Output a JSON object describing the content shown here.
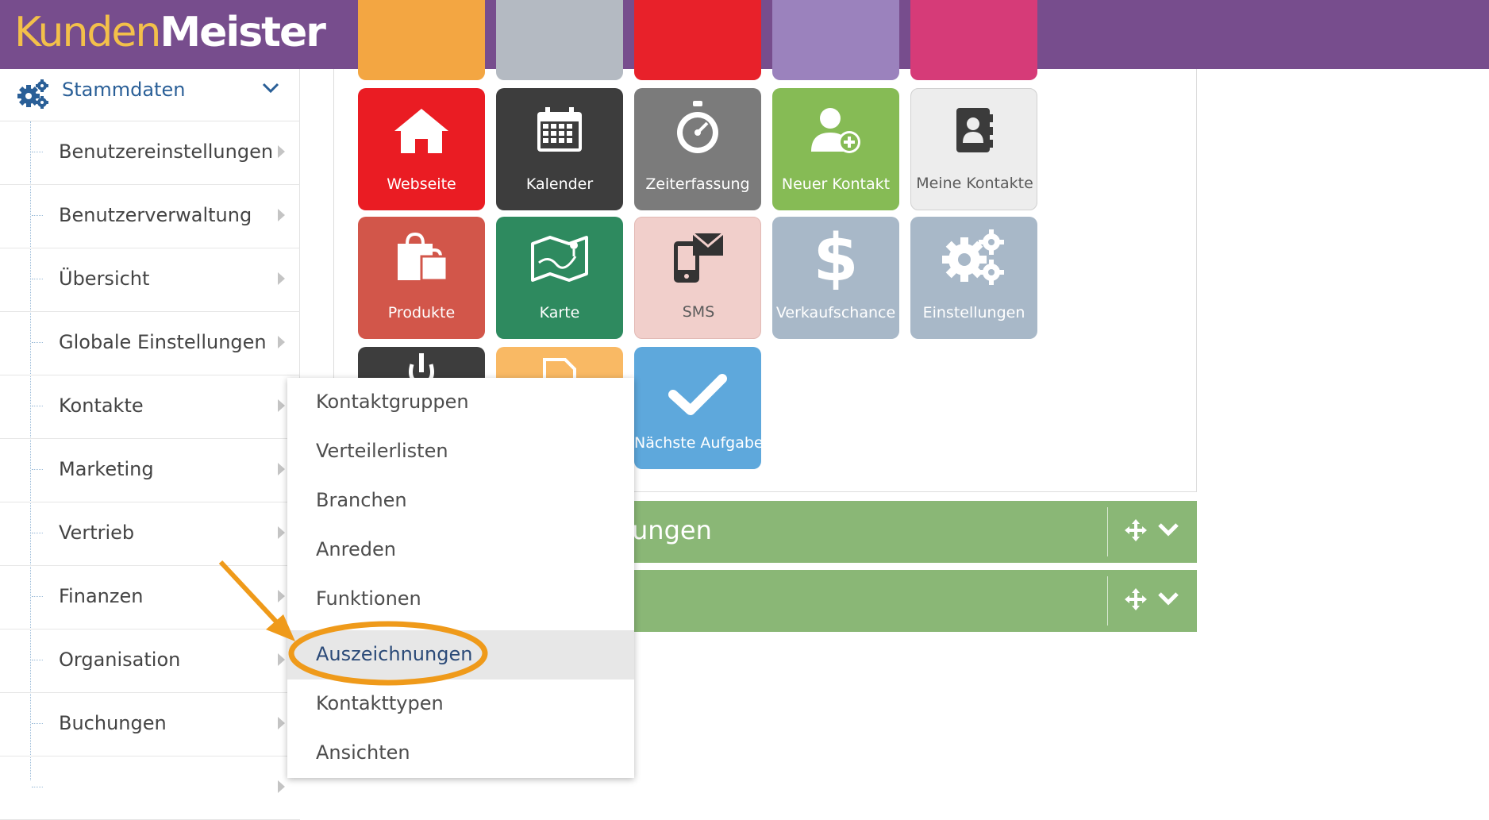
{
  "brand": {
    "part1": "Kunden",
    "part2": "Meister"
  },
  "sidebar": {
    "header": "Stammdaten",
    "items": [
      {
        "label": "Benutzereinstellungen"
      },
      {
        "label": "Benutzerverwaltung"
      },
      {
        "label": "Übersicht"
      },
      {
        "label": "Globale Einstellungen"
      },
      {
        "label": "Kontakte"
      },
      {
        "label": "Marketing"
      },
      {
        "label": "Vertrieb"
      },
      {
        "label": "Finanzen"
      },
      {
        "label": "Organisation"
      },
      {
        "label": "Buchungen"
      }
    ]
  },
  "tiles": {
    "webseite": "Webseite",
    "kalender": "Kalender",
    "zeiterfassung": "Zeiterfassung",
    "neuer_kontakt": "Neuer Kontakt",
    "meine_kontakte": "Meine Kontakte",
    "produkte": "Produkte",
    "karte": "Karte",
    "sms": "SMS",
    "verkaufschance": "Verkaufschance",
    "einstellungen": "Einstellungen",
    "naechste_aufgabe": "Nächste Aufgabe"
  },
  "widgets": {
    "strip1_title": "ungen"
  },
  "dropdown": {
    "items": [
      {
        "label": "Kontaktgruppen"
      },
      {
        "label": "Verteilerlisten"
      },
      {
        "label": "Branchen"
      },
      {
        "label": "Anreden"
      },
      {
        "label": "Funktionen"
      },
      {
        "label": "Auszeichnungen"
      },
      {
        "label": "Kontakttypen"
      },
      {
        "label": "Ansichten"
      }
    ],
    "highlighted": "Auszeichnungen"
  },
  "colors": {
    "topbar": "#774d8d",
    "accent_gold": "#f3c04a",
    "widget_green": "#8ab776",
    "annotation_orange": "#ef9a1a"
  }
}
